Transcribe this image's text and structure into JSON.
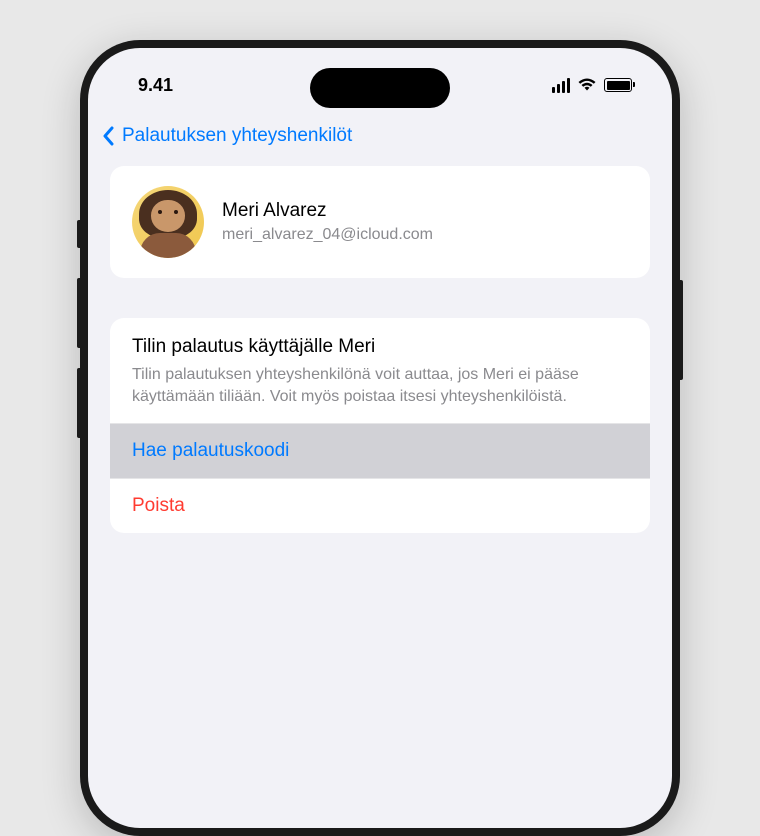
{
  "statusBar": {
    "time": "9.41"
  },
  "nav": {
    "backLabel": "Palautuksen yhteyshenkilöt"
  },
  "contact": {
    "name": "Meri Alvarez",
    "email": "meri_alvarez_04@icloud.com"
  },
  "recovery": {
    "title": "Tilin palautus käyttäjälle Meri",
    "description": "Tilin palautuksen yhteyshenkilönä voit auttaa, jos Meri ei pääse käyttämään tiliään. Voit myös poistaa itsesi yhteyshenkilöistä.",
    "getCodeLabel": "Hae palautuskoodi",
    "removeLabel": "Poista"
  }
}
